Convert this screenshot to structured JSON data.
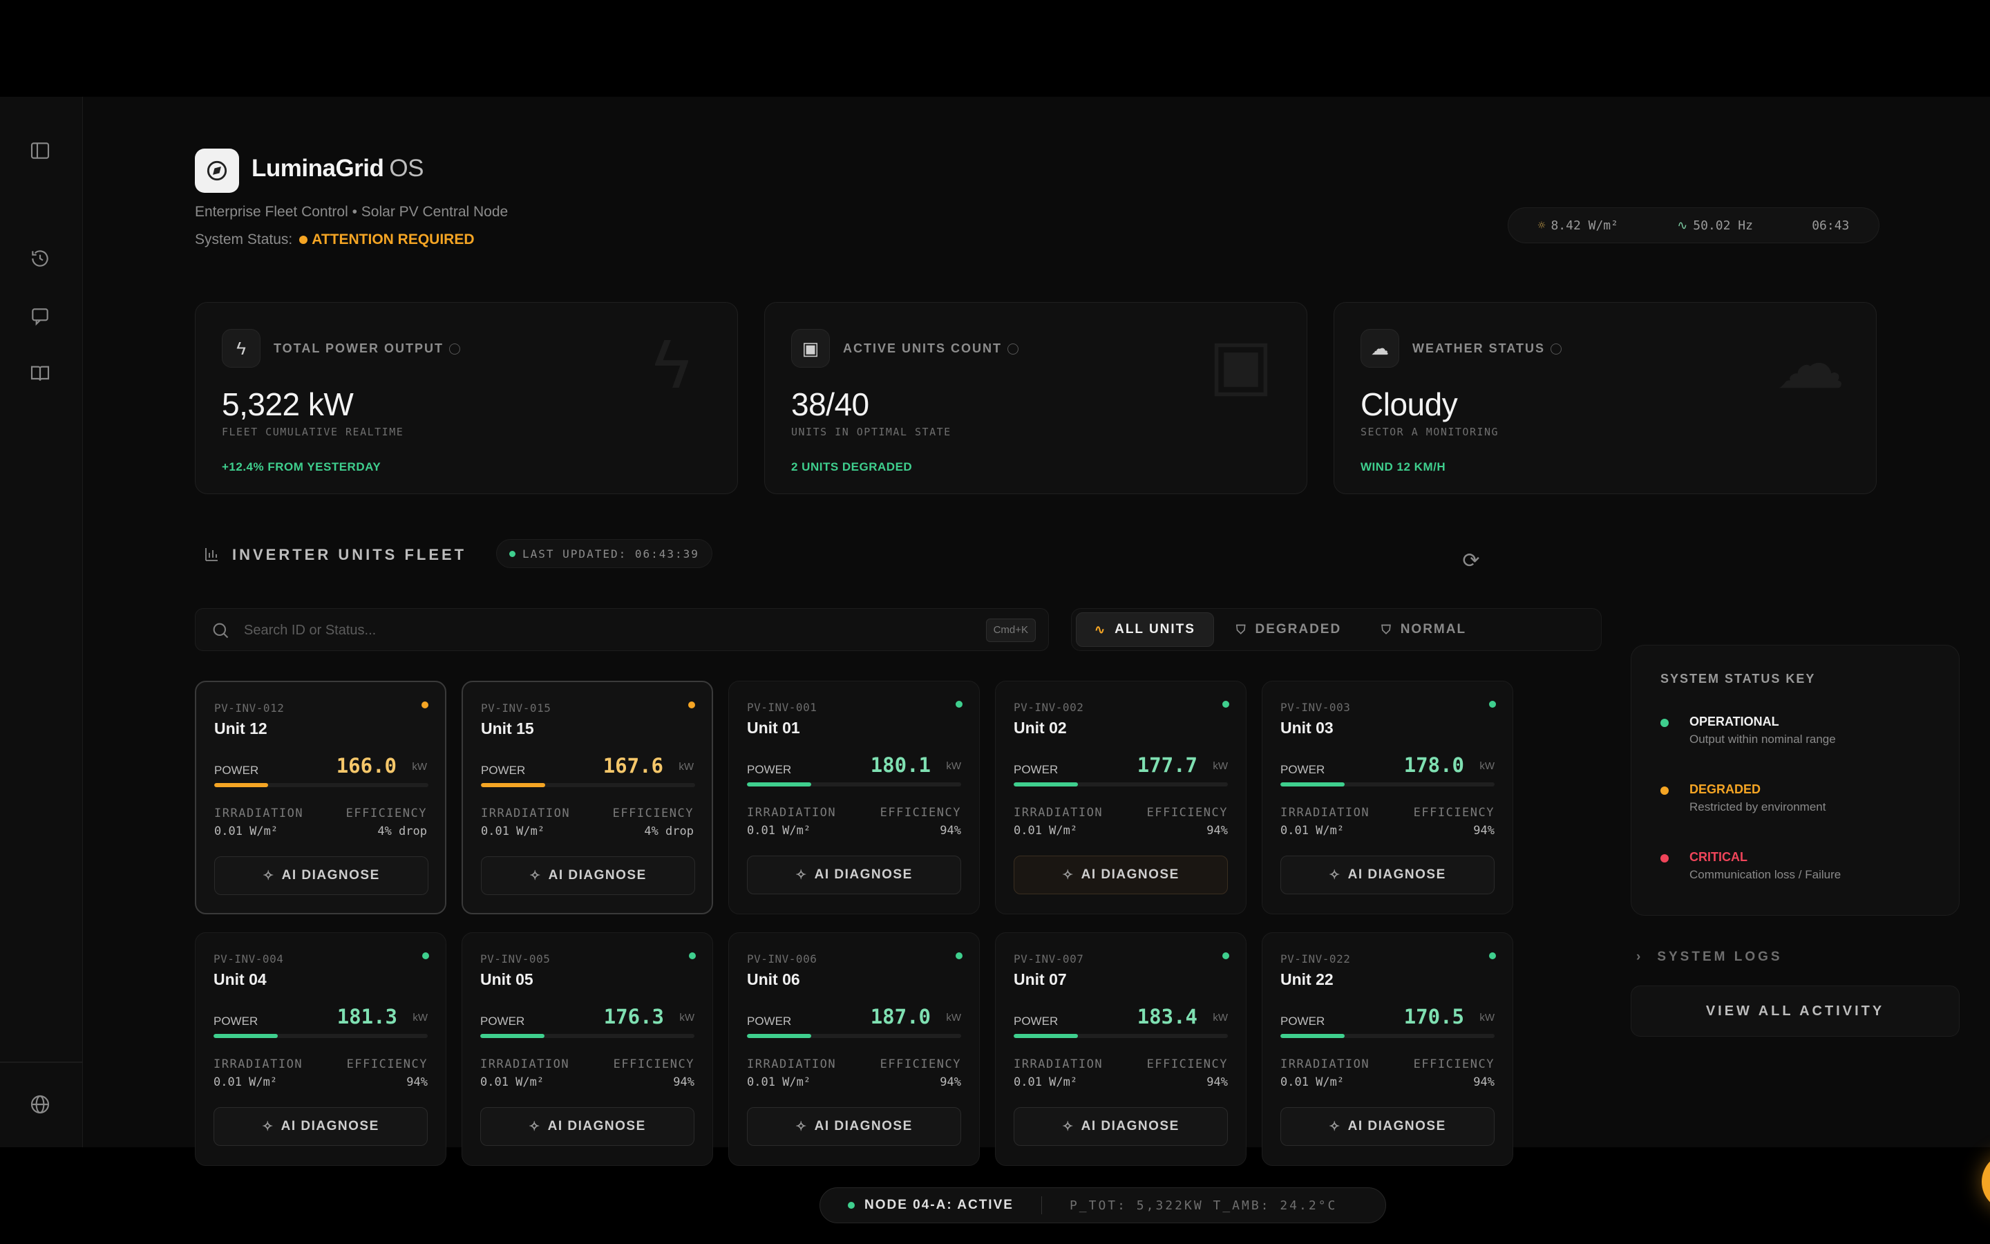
{
  "header": {
    "brand": "LuminaGrid",
    "brand_suffix": "OS",
    "subtitle": "Enterprise Fleet Control • Solar PV Central Node",
    "status_label": "System Status:",
    "status_value": "ATTENTION REQUIRED"
  },
  "telemetry": {
    "irradiance": "8.42 W/m²",
    "frequency": "50.02 Hz",
    "time": "06:43"
  },
  "kpis": [
    {
      "label": "TOTAL POWER OUTPUT",
      "value": "5,322 kW",
      "sub": "FLEET CUMULATIVE REALTIME",
      "foot": "+12.4% FROM YESTERDAY",
      "icon": "bolt-icon"
    },
    {
      "label": "ACTIVE UNITS COUNT",
      "value": "38/40",
      "sub": "UNITS IN OPTIMAL STATE",
      "foot": "2 UNITS DEGRADED",
      "icon": "chip-icon"
    },
    {
      "label": "WEATHER STATUS",
      "value": "Cloudy",
      "sub": "SECTOR A MONITORING",
      "foot": "WIND 12 KM/H",
      "icon": "cloud-icon"
    }
  ],
  "fleet": {
    "title": "INVERTER UNITS FLEET",
    "last_updated": "LAST UPDATED: 06:43:39",
    "search_placeholder": "Search ID or Status...",
    "shortcut": "Cmd+K",
    "filters": [
      "ALL UNITS",
      "DEGRADED",
      "NORMAL"
    ],
    "labels": {
      "power": "POWER",
      "unit": "kW",
      "irradiation": "IRRADIATION",
      "efficiency": "EFFICIENCY",
      "diagnose": "AI DIAGNOSE"
    }
  },
  "units": [
    {
      "id": "PV-INV-012",
      "name": "Unit 12",
      "power": "166.0",
      "power_fraction": 0.25,
      "irradiation": "0.01 W/m²",
      "efficiency": "4% drop",
      "status": "degraded"
    },
    {
      "id": "PV-INV-015",
      "name": "Unit 15",
      "power": "167.6",
      "power_fraction": 0.3,
      "irradiation": "0.01 W/m²",
      "efficiency": "4% drop",
      "status": "degraded"
    },
    {
      "id": "PV-INV-001",
      "name": "Unit 01",
      "power": "180.1",
      "power_fraction": 0.3,
      "irradiation": "0.01 W/m²",
      "efficiency": "94%",
      "status": "operational"
    },
    {
      "id": "PV-INV-002",
      "name": "Unit 02",
      "power": "177.7",
      "power_fraction": 0.3,
      "irradiation": "0.01 W/m²",
      "efficiency": "94%",
      "status": "operational"
    },
    {
      "id": "PV-INV-003",
      "name": "Unit 03",
      "power": "178.0",
      "power_fraction": 0.3,
      "irradiation": "0.01 W/m²",
      "efficiency": "94%",
      "status": "operational"
    },
    {
      "id": "PV-INV-004",
      "name": "Unit 04",
      "power": "181.3",
      "power_fraction": 0.3,
      "irradiation": "0.01 W/m²",
      "efficiency": "94%",
      "status": "operational"
    },
    {
      "id": "PV-INV-005",
      "name": "Unit 05",
      "power": "176.3",
      "power_fraction": 0.3,
      "irradiation": "0.01 W/m²",
      "efficiency": "94%",
      "status": "operational"
    },
    {
      "id": "PV-INV-006",
      "name": "Unit 06",
      "power": "187.0",
      "power_fraction": 0.3,
      "irradiation": "0.01 W/m²",
      "efficiency": "94%",
      "status": "operational"
    },
    {
      "id": "PV-INV-007",
      "name": "Unit 07",
      "power": "183.4",
      "power_fraction": 0.3,
      "irradiation": "0.01 W/m²",
      "efficiency": "94%",
      "status": "operational"
    },
    {
      "id": "PV-INV-022",
      "name": "Unit 22",
      "power": "170.5",
      "power_fraction": 0.3,
      "irradiation": "0.01 W/m²",
      "efficiency": "94%",
      "status": "operational"
    }
  ],
  "status_key": {
    "title": "SYSTEM STATUS KEY",
    "items": [
      {
        "name": "OPERATIONAL",
        "desc": "Output within nominal range",
        "color": "#3fcf8e"
      },
      {
        "name": "DEGRADED",
        "desc": "Restricted by environment",
        "color": "#f5a524"
      },
      {
        "name": "CRITICAL",
        "desc": "Communication loss / Failure",
        "color": "#f0455a"
      }
    ]
  },
  "logs": {
    "title": "SYSTEM LOGS",
    "view_all": "VIEW ALL ACTIVITY"
  },
  "node_bar": {
    "status": "NODE 04-A: ACTIVE",
    "metrics": "P_TOT: 5,322KW  T_AMB: 24.2°C"
  },
  "colors": {
    "accent": "#f5a524",
    "ok": "#3fcf8e",
    "critical": "#f0455a",
    "degraded_value": "#f5c76a",
    "ok_value": "#7fe0b2"
  }
}
